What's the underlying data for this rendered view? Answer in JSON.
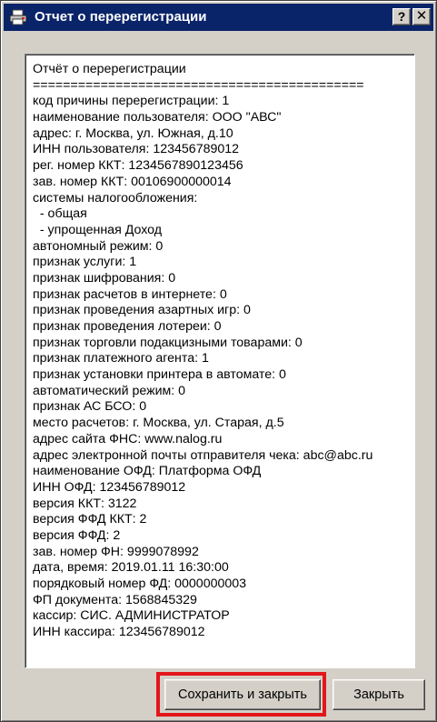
{
  "window": {
    "title": "Отчет о перерегистрации",
    "help_label": "?",
    "close_label": "✕"
  },
  "report": {
    "lines": [
      "Отчёт о перерегистрации",
      "============================================",
      "код причины перерегистрации: 1",
      "наименование пользователя: ООО \"АВС\"",
      "адрес: г. Москва, ул. Южная, д.10",
      "ИНН пользователя: 123456789012",
      "рег. номер ККТ: 1234567890123456",
      "зав. номер ККТ: 00106900000014",
      "системы налогообложения:",
      "  - общая",
      "  - упрощенная Доход",
      "автономный режим: 0",
      "признак услуги: 1",
      "признак шифрования: 0",
      "признак расчетов в интернете: 0",
      "признак проведения азартных игр: 0",
      "признак проведения лотереи: 0",
      "признак торговли подакцизными товарами: 0",
      "признак платежного агента: 1",
      "признак установки принтера в автомате: 0",
      "автоматический режим: 0",
      "признак АС БСО: 0",
      "место расчетов: г. Москва, ул. Старая, д.5",
      "адрес сайта ФНС: www.nalog.ru",
      "адрес электронной почты отправителя чека: abc@abc.ru",
      "наименование ОФД: Платформа ОФД",
      "ИНН ОФД: 123456789012",
      "версия ККТ: 3122",
      "версия ФФД ККТ: 2",
      "версия ФФД: 2",
      "зав. номер ФН: 9999078992",
      "дата, время: 2019.01.11 16:30:00",
      "порядковый номер ФД: 0000000003",
      "ФП документа: 1568845329",
      "кассир: СИС. АДМИНИСТРАТОР",
      "ИНН кассира: 123456789012"
    ]
  },
  "buttons": {
    "save_close_label": "Сохранить и закрыть",
    "close_label": "Закрыть"
  },
  "colors": {
    "titlebar": "#0a246a",
    "highlight": "#e3161b",
    "face": "#d4d0c8"
  }
}
